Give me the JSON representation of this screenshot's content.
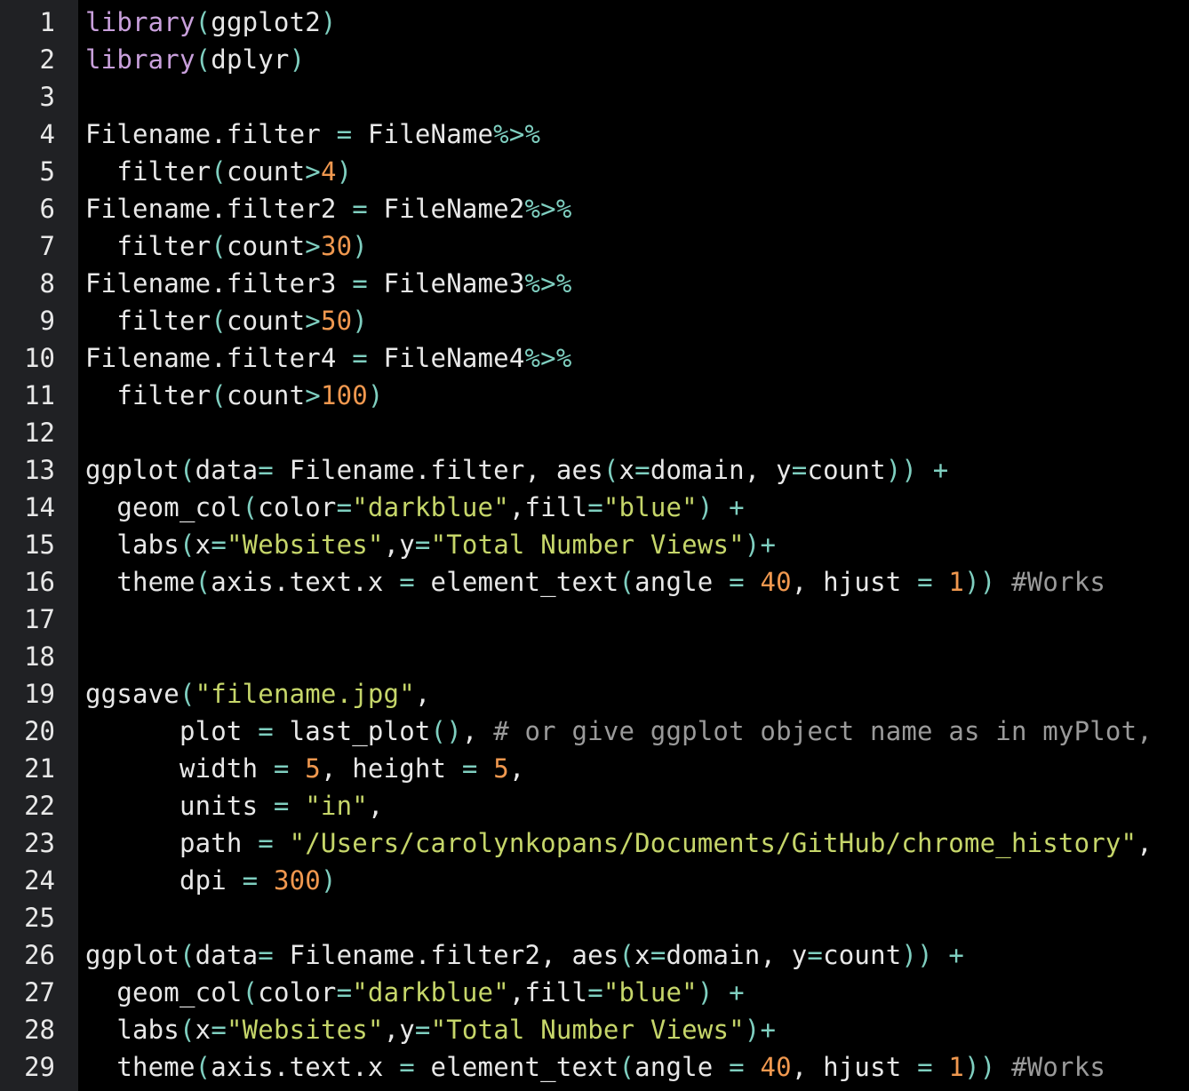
{
  "editor": {
    "background": "#000000",
    "gutter_background": "#202124",
    "colors": {
      "plain": "#e8e8e8",
      "keyword": "#c9a0dc",
      "punct": "#7fcfc0",
      "op": "#7fcfc0",
      "number": "#f0984f",
      "string": "#c6d66a",
      "comment": "#9a9a9a"
    },
    "lines": [
      {
        "n": "1",
        "tokens": [
          [
            "keyword",
            "library"
          ],
          [
            "punct",
            "("
          ],
          [
            "plain",
            "ggplot2"
          ],
          [
            "punct",
            ")"
          ]
        ]
      },
      {
        "n": "2",
        "tokens": [
          [
            "keyword",
            "library"
          ],
          [
            "punct",
            "("
          ],
          [
            "plain",
            "dplyr"
          ],
          [
            "punct",
            ")"
          ]
        ]
      },
      {
        "n": "3",
        "tokens": []
      },
      {
        "n": "4",
        "tokens": [
          [
            "plain",
            "Filename.filter "
          ],
          [
            "op",
            "="
          ],
          [
            "plain",
            " FileName"
          ],
          [
            "op",
            "%>%"
          ]
        ]
      },
      {
        "n": "5",
        "tokens": [
          [
            "plain",
            "  filter"
          ],
          [
            "punct",
            "("
          ],
          [
            "plain",
            "count"
          ],
          [
            "op",
            ">"
          ],
          [
            "number",
            "4"
          ],
          [
            "punct",
            ")"
          ]
        ]
      },
      {
        "n": "6",
        "tokens": [
          [
            "plain",
            "Filename.filter2 "
          ],
          [
            "op",
            "="
          ],
          [
            "plain",
            " FileName2"
          ],
          [
            "op",
            "%>%"
          ]
        ]
      },
      {
        "n": "7",
        "tokens": [
          [
            "plain",
            "  filter"
          ],
          [
            "punct",
            "("
          ],
          [
            "plain",
            "count"
          ],
          [
            "op",
            ">"
          ],
          [
            "number",
            "30"
          ],
          [
            "punct",
            ")"
          ]
        ]
      },
      {
        "n": "8",
        "tokens": [
          [
            "plain",
            "Filename.filter3 "
          ],
          [
            "op",
            "="
          ],
          [
            "plain",
            " FileName3"
          ],
          [
            "op",
            "%>%"
          ]
        ]
      },
      {
        "n": "9",
        "tokens": [
          [
            "plain",
            "  filter"
          ],
          [
            "punct",
            "("
          ],
          [
            "plain",
            "count"
          ],
          [
            "op",
            ">"
          ],
          [
            "number",
            "50"
          ],
          [
            "punct",
            ")"
          ]
        ]
      },
      {
        "n": "10",
        "tokens": [
          [
            "plain",
            "Filename.filter4 "
          ],
          [
            "op",
            "="
          ],
          [
            "plain",
            " FileName4"
          ],
          [
            "op",
            "%>%"
          ]
        ]
      },
      {
        "n": "11",
        "tokens": [
          [
            "plain",
            "  filter"
          ],
          [
            "punct",
            "("
          ],
          [
            "plain",
            "count"
          ],
          [
            "op",
            ">"
          ],
          [
            "number",
            "100"
          ],
          [
            "punct",
            ")"
          ]
        ]
      },
      {
        "n": "12",
        "tokens": []
      },
      {
        "n": "13",
        "tokens": [
          [
            "plain",
            "ggplot"
          ],
          [
            "punct",
            "("
          ],
          [
            "plain",
            "data"
          ],
          [
            "op",
            "="
          ],
          [
            "plain",
            " Filename.filter, aes"
          ],
          [
            "punct",
            "("
          ],
          [
            "plain",
            "x"
          ],
          [
            "op",
            "="
          ],
          [
            "plain",
            "domain, y"
          ],
          [
            "op",
            "="
          ],
          [
            "plain",
            "count"
          ],
          [
            "punct",
            "))"
          ],
          [
            "plain",
            " "
          ],
          [
            "op",
            "+"
          ]
        ]
      },
      {
        "n": "14",
        "tokens": [
          [
            "plain",
            "  geom_col"
          ],
          [
            "punct",
            "("
          ],
          [
            "plain",
            "color"
          ],
          [
            "op",
            "="
          ],
          [
            "string",
            "\"darkblue\""
          ],
          [
            "plain",
            ",fill"
          ],
          [
            "op",
            "="
          ],
          [
            "string",
            "\"blue\""
          ],
          [
            "punct",
            ")"
          ],
          [
            "plain",
            " "
          ],
          [
            "op",
            "+"
          ]
        ]
      },
      {
        "n": "15",
        "tokens": [
          [
            "plain",
            "  labs"
          ],
          [
            "punct",
            "("
          ],
          [
            "plain",
            "x"
          ],
          [
            "op",
            "="
          ],
          [
            "string",
            "\"Websites\""
          ],
          [
            "plain",
            ",y"
          ],
          [
            "op",
            "="
          ],
          [
            "string",
            "\"Total Number Views\""
          ],
          [
            "punct",
            ")"
          ],
          [
            "op",
            "+"
          ]
        ]
      },
      {
        "n": "16",
        "tokens": [
          [
            "plain",
            "  theme"
          ],
          [
            "punct",
            "("
          ],
          [
            "plain",
            "axis.text.x "
          ],
          [
            "op",
            "="
          ],
          [
            "plain",
            " element_text"
          ],
          [
            "punct",
            "("
          ],
          [
            "plain",
            "angle "
          ],
          [
            "op",
            "="
          ],
          [
            "plain",
            " "
          ],
          [
            "number",
            "40"
          ],
          [
            "plain",
            ", hjust "
          ],
          [
            "op",
            "="
          ],
          [
            "plain",
            " "
          ],
          [
            "number",
            "1"
          ],
          [
            "punct",
            "))"
          ],
          [
            "plain",
            " "
          ],
          [
            "comment",
            "#Works"
          ]
        ]
      },
      {
        "n": "17",
        "tokens": []
      },
      {
        "n": "18",
        "tokens": []
      },
      {
        "n": "19",
        "tokens": [
          [
            "plain",
            "ggsave"
          ],
          [
            "punct",
            "("
          ],
          [
            "string",
            "\"filename.jpg\""
          ],
          [
            "plain",
            ","
          ]
        ]
      },
      {
        "n": "20",
        "tokens": [
          [
            "plain",
            "      plot "
          ],
          [
            "op",
            "="
          ],
          [
            "plain",
            " last_plot"
          ],
          [
            "punct",
            "()"
          ],
          [
            "plain",
            ", "
          ],
          [
            "comment",
            "# or give ggplot object name as in myPlot,"
          ]
        ]
      },
      {
        "n": "21",
        "tokens": [
          [
            "plain",
            "      width "
          ],
          [
            "op",
            "="
          ],
          [
            "plain",
            " "
          ],
          [
            "number",
            "5"
          ],
          [
            "plain",
            ", height "
          ],
          [
            "op",
            "="
          ],
          [
            "plain",
            " "
          ],
          [
            "number",
            "5"
          ],
          [
            "plain",
            ","
          ]
        ]
      },
      {
        "n": "22",
        "tokens": [
          [
            "plain",
            "      units "
          ],
          [
            "op",
            "="
          ],
          [
            "plain",
            " "
          ],
          [
            "string",
            "\"in\""
          ],
          [
            "plain",
            ","
          ]
        ]
      },
      {
        "n": "23",
        "tokens": [
          [
            "plain",
            "      path "
          ],
          [
            "op",
            "="
          ],
          [
            "plain",
            " "
          ],
          [
            "string",
            "\"/Users/carolynkopans/Documents/GitHub/chrome_history\""
          ],
          [
            "plain",
            ","
          ]
        ]
      },
      {
        "n": "24",
        "tokens": [
          [
            "plain",
            "      dpi "
          ],
          [
            "op",
            "="
          ],
          [
            "plain",
            " "
          ],
          [
            "number",
            "300"
          ],
          [
            "punct",
            ")"
          ]
        ]
      },
      {
        "n": "25",
        "tokens": []
      },
      {
        "n": "26",
        "tokens": [
          [
            "plain",
            "ggplot"
          ],
          [
            "punct",
            "("
          ],
          [
            "plain",
            "data"
          ],
          [
            "op",
            "="
          ],
          [
            "plain",
            " Filename.filter2, aes"
          ],
          [
            "punct",
            "("
          ],
          [
            "plain",
            "x"
          ],
          [
            "op",
            "="
          ],
          [
            "plain",
            "domain, y"
          ],
          [
            "op",
            "="
          ],
          [
            "plain",
            "count"
          ],
          [
            "punct",
            "))"
          ],
          [
            "plain",
            " "
          ],
          [
            "op",
            "+"
          ]
        ]
      },
      {
        "n": "27",
        "tokens": [
          [
            "plain",
            "  geom_col"
          ],
          [
            "punct",
            "("
          ],
          [
            "plain",
            "color"
          ],
          [
            "op",
            "="
          ],
          [
            "string",
            "\"darkblue\""
          ],
          [
            "plain",
            ",fill"
          ],
          [
            "op",
            "="
          ],
          [
            "string",
            "\"blue\""
          ],
          [
            "punct",
            ")"
          ],
          [
            "plain",
            " "
          ],
          [
            "op",
            "+"
          ]
        ]
      },
      {
        "n": "28",
        "tokens": [
          [
            "plain",
            "  labs"
          ],
          [
            "punct",
            "("
          ],
          [
            "plain",
            "x"
          ],
          [
            "op",
            "="
          ],
          [
            "string",
            "\"Websites\""
          ],
          [
            "plain",
            ",y"
          ],
          [
            "op",
            "="
          ],
          [
            "string",
            "\"Total Number Views\""
          ],
          [
            "punct",
            ")"
          ],
          [
            "op",
            "+"
          ]
        ]
      },
      {
        "n": "29",
        "tokens": [
          [
            "plain",
            "  theme"
          ],
          [
            "punct",
            "("
          ],
          [
            "plain",
            "axis.text.x "
          ],
          [
            "op",
            "="
          ],
          [
            "plain",
            " element_text"
          ],
          [
            "punct",
            "("
          ],
          [
            "plain",
            "angle "
          ],
          [
            "op",
            "="
          ],
          [
            "plain",
            " "
          ],
          [
            "number",
            "40"
          ],
          [
            "plain",
            ", hjust "
          ],
          [
            "op",
            "="
          ],
          [
            "plain",
            " "
          ],
          [
            "number",
            "1"
          ],
          [
            "punct",
            "))"
          ],
          [
            "plain",
            " "
          ],
          [
            "comment",
            "#Works"
          ]
        ]
      }
    ]
  }
}
